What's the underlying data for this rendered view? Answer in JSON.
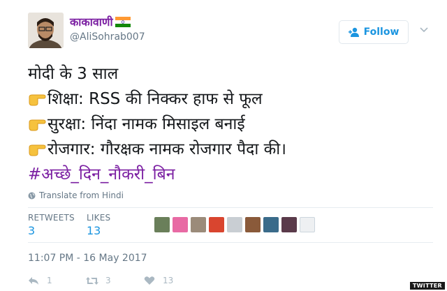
{
  "user": {
    "display_name": "काकावाणी",
    "handle": "@AliSohrab007",
    "flag_icon": "india-flag-icon"
  },
  "follow_button": {
    "label": "Follow",
    "icon": "add-user-icon"
  },
  "more_menu": {
    "icon": "chevron-down-icon"
  },
  "tweet": {
    "line1": "मोदी के 3 साल",
    "line2": "शिक्षा: RSS की निक्कर हाफ से फूल",
    "line3": "सुरक्षा: निंदा नामक मिसाइल बनाई",
    "line4": "रोजगार: गौरक्षक नामक रोजगार पैदा की।",
    "hashtag": "#अच्छे_दिन_नौकरी_बिन",
    "bullet_icon": "pointing-hand-icon"
  },
  "translate": {
    "label": "Translate from Hindi",
    "icon": "globe-icon"
  },
  "stats": {
    "retweets_label": "RETWEETS",
    "retweets_value": "3",
    "likes_label": "LIKES",
    "likes_value": "13"
  },
  "timestamp": "11:07 PM - 16 May 2017",
  "actions": {
    "reply_count": "1",
    "retweet_count": "3",
    "like_count": "13"
  },
  "watermark": "TWITTER",
  "colors": {
    "accent": "#1b95e0",
    "name_purple": "#7b1fa2",
    "secondary": "#657786"
  }
}
